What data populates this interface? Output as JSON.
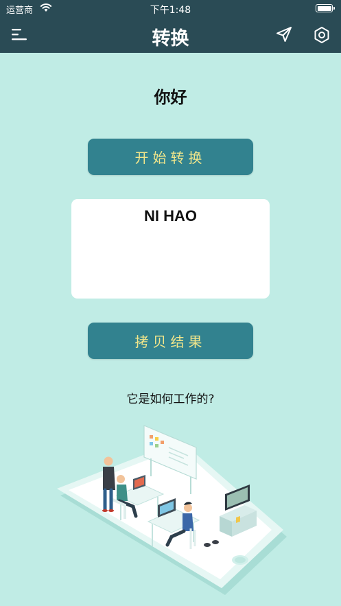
{
  "status_bar": {
    "carrier": "运营商",
    "time": "下午1:48"
  },
  "header": {
    "title": "转换",
    "menu_icon": "menu-icon",
    "send_icon": "send-icon",
    "settings_icon": "settings-icon"
  },
  "main": {
    "source_text": "你好",
    "convert_button": "开始转换",
    "result_text": "NI HAO",
    "copy_button": "拷贝结果",
    "how_it_works": "它是如何工作的?"
  },
  "colors": {
    "background": "#c0ece5",
    "header": "#2a4b55",
    "button": "#32828f",
    "button_text": "#f1e68b"
  }
}
